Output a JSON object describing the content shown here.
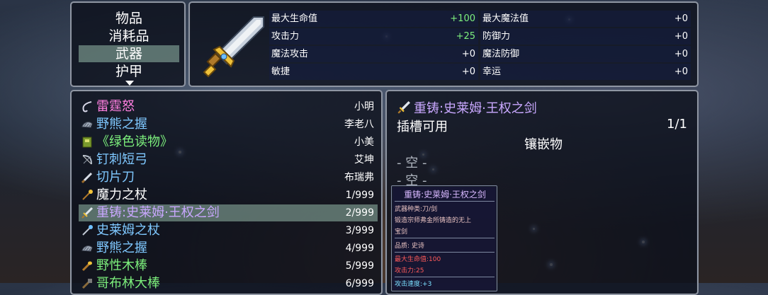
{
  "menu": {
    "categories": [
      "物品",
      "消耗品",
      "武器",
      "护甲"
    ],
    "selected_index": 2
  },
  "equip_stats": {
    "left": [
      {
        "label": "最大生命值",
        "value": "+100",
        "color": "#7df07d"
      },
      {
        "label": "攻击力",
        "value": "+25",
        "color": "#7df07d"
      },
      {
        "label": "魔法攻击",
        "value": "+0",
        "color": "#ffffff"
      },
      {
        "label": "敏捷",
        "value": "+0",
        "color": "#ffffff"
      }
    ],
    "right": [
      {
        "label": "最大魔法值",
        "value": "+0",
        "color": "#ffffff"
      },
      {
        "label": "防御力",
        "value": "+0",
        "color": "#ffffff"
      },
      {
        "label": "魔法防御",
        "value": "+0",
        "color": "#ffffff"
      },
      {
        "label": "幸运",
        "value": "+0",
        "color": "#ffffff"
      }
    ]
  },
  "items": [
    {
      "icon": "whip-icon",
      "name": "雷霆怒",
      "owner": "小明",
      "color": "#ff7fe0"
    },
    {
      "icon": "claw-icon",
      "name": "野熊之握",
      "owner": "李老八",
      "color": "#7fc8ff"
    },
    {
      "icon": "book-icon",
      "name": "《绿色读物》",
      "owner": "小美",
      "color": "#7df07d"
    },
    {
      "icon": "bow-icon",
      "name": "钉刺短弓",
      "owner": "艾坤",
      "color": "#7fc8ff"
    },
    {
      "icon": "knife-icon",
      "name": "切片刀",
      "owner": "布瑞弗",
      "color": "#7fc8ff"
    },
    {
      "icon": "staff-icon",
      "name": "魔力之杖",
      "owner": "1/999",
      "color": "#ffffff"
    },
    {
      "icon": "sword-icon",
      "name": "重铸:史莱姆·王权之剑",
      "owner": "2/999",
      "color": "#c9a8ff"
    },
    {
      "icon": "wand-icon",
      "name": "史莱姆之杖",
      "owner": "3/999",
      "color": "#7fc8ff"
    },
    {
      "icon": "claw-icon",
      "name": "野熊之握",
      "owner": "4/999",
      "color": "#7fc8ff"
    },
    {
      "icon": "club-icon",
      "name": "野性木棒",
      "owner": "5/999",
      "color": "#7df07d"
    },
    {
      "icon": "hammer-icon",
      "name": "哥布林大棒",
      "owner": "6/999",
      "color": "#7df07d"
    }
  ],
  "selected_item_index": 6,
  "detail": {
    "title": "重铸:史莱姆·王权之剑",
    "slot_label": "插槽可用",
    "slot_count": "1/1",
    "inlay_label": "镶嵌物",
    "empty_slots": [
      "- 空 -",
      "- 空 -"
    ]
  },
  "tooltip": {
    "title": "重铸:史莱姆·王权之剑",
    "type_line": "武器种类:刀/剑",
    "desc_line1": "锻造宗师弗金所铸造的无上",
    "desc_line2": "宝剑",
    "quality_line": "品质: 史诗",
    "stat_line1": "最大生命值:100",
    "stat_line2": "攻击力:25",
    "partial_line": "攻击速度:+3"
  }
}
